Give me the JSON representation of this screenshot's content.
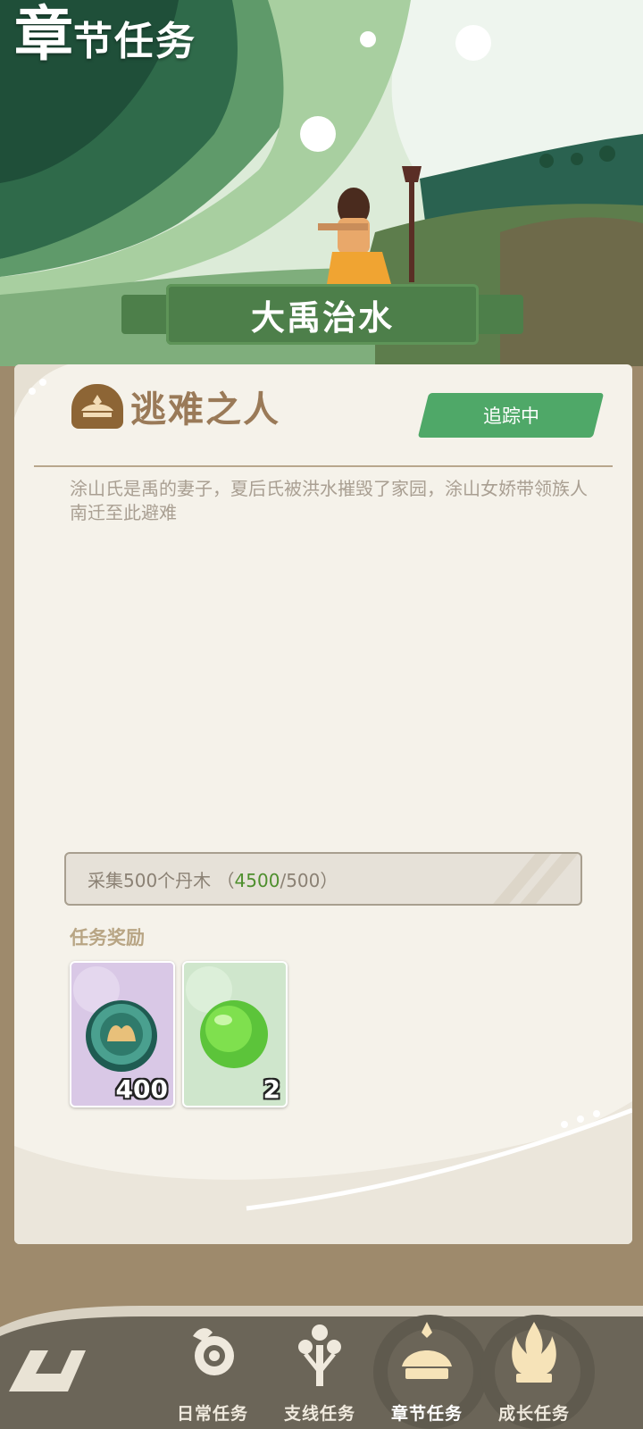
{
  "header": {
    "title_first_char": "章",
    "title_rest": "节任务",
    "chapter_name": "大禹治水"
  },
  "quest": {
    "title": "逃难之人",
    "track_button": "追踪中",
    "description": "涂山氏是禹的妻子，夏后氏被洪水摧毁了家园，涂山女娇带领族人南迁至此避难",
    "objective": {
      "prefix": "采集500个丹木",
      "open": " （",
      "current": "4500",
      "separator": "/",
      "target": "500",
      "close": "）"
    },
    "rewards_label": "任务奖励",
    "rewards": [
      {
        "icon": "jade-coin-icon",
        "quantity": "400",
        "bg": "#d9c8e6"
      },
      {
        "icon": "green-orb-icon",
        "quantity": "2",
        "bg": "#cfe6cc"
      }
    ]
  },
  "nav": {
    "tabs": [
      {
        "label": "日常任务",
        "icon": "bird-icon",
        "active": false
      },
      {
        "label": "支线任务",
        "icon": "branch-icon",
        "active": false
      },
      {
        "label": "章节任务",
        "icon": "crown-icon",
        "active": true
      },
      {
        "label": "成长任务",
        "icon": "flame-icon",
        "active": false
      }
    ]
  },
  "colors": {
    "accent_green": "#4fa868",
    "plate_green": "#4d7f4a",
    "progress_current": "#4e8f2d",
    "background": "#9e8a6c",
    "card": "#f5f2ea"
  }
}
